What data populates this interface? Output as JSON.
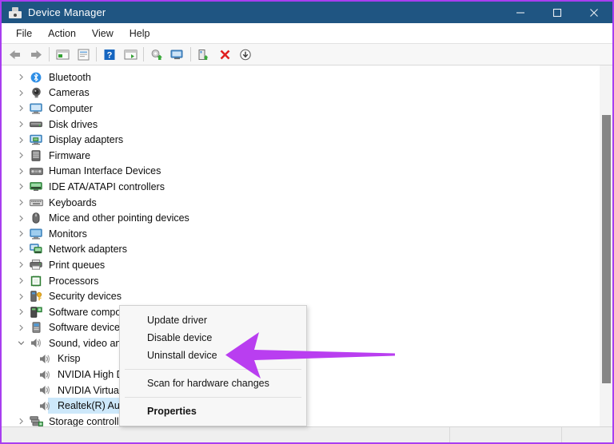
{
  "window": {
    "title": "Device Manager",
    "icon": "device-manager-icon",
    "controls": {
      "minimize": "minimize-icon",
      "maximize": "maximize-icon",
      "close": "close-icon"
    },
    "accent_border": "#a83ef0",
    "titlebar_color": "#1f5582"
  },
  "menubar": {
    "items": [
      {
        "label": "File"
      },
      {
        "label": "Action"
      },
      {
        "label": "View"
      },
      {
        "label": "Help"
      }
    ]
  },
  "toolbar": {
    "buttons": [
      {
        "name": "back-arrow-icon",
        "title": "Back"
      },
      {
        "name": "forward-arrow-icon",
        "title": "Forward"
      },
      {
        "name": "separator-1"
      },
      {
        "name": "show-hidden-devices-icon",
        "title": "Show hidden devices"
      },
      {
        "name": "properties-icon",
        "title": "Properties"
      },
      {
        "name": "separator-2"
      },
      {
        "name": "help-icon",
        "title": "Help"
      },
      {
        "name": "console-icon",
        "title": "Console"
      },
      {
        "name": "separator-3"
      },
      {
        "name": "update-driver-icon",
        "title": "Update driver"
      },
      {
        "name": "scan-hardware-icon",
        "title": "Scan for hardware changes"
      },
      {
        "name": "separator-4"
      },
      {
        "name": "enable-device-icon",
        "title": "Enable device"
      },
      {
        "name": "uninstall-device-icon",
        "title": "Uninstall device"
      },
      {
        "name": "disable-device-icon",
        "title": "Disable device"
      }
    ]
  },
  "tree": {
    "items": [
      {
        "label": "Bluetooth",
        "icon": "bluetooth-icon",
        "expander": "collapsed",
        "level": 0
      },
      {
        "label": "Cameras",
        "icon": "camera-icon",
        "expander": "collapsed",
        "level": 0
      },
      {
        "label": "Computer",
        "icon": "computer-icon",
        "expander": "collapsed",
        "level": 0
      },
      {
        "label": "Disk drives",
        "icon": "disk-drive-icon",
        "expander": "collapsed",
        "level": 0
      },
      {
        "label": "Display adapters",
        "icon": "display-adapter-icon",
        "expander": "collapsed",
        "level": 0
      },
      {
        "label": "Firmware",
        "icon": "firmware-icon",
        "expander": "collapsed",
        "level": 0
      },
      {
        "label": "Human Interface Devices",
        "icon": "hid-icon",
        "expander": "collapsed",
        "level": 0
      },
      {
        "label": "IDE ATA/ATAPI controllers",
        "icon": "ide-controller-icon",
        "expander": "collapsed",
        "level": 0
      },
      {
        "label": "Keyboards",
        "icon": "keyboard-icon",
        "expander": "collapsed",
        "level": 0
      },
      {
        "label": "Mice and other pointing devices",
        "icon": "mouse-icon",
        "expander": "collapsed",
        "level": 0
      },
      {
        "label": "Monitors",
        "icon": "monitor-icon",
        "expander": "collapsed",
        "level": 0
      },
      {
        "label": "Network adapters",
        "icon": "network-adapter-icon",
        "expander": "collapsed",
        "level": 0
      },
      {
        "label": "Print queues",
        "icon": "printer-icon",
        "expander": "collapsed",
        "level": 0
      },
      {
        "label": "Processors",
        "icon": "processor-icon",
        "expander": "collapsed",
        "level": 0
      },
      {
        "label": "Security devices",
        "icon": "security-device-icon",
        "expander": "collapsed",
        "level": 0
      },
      {
        "label": "Software components",
        "icon": "software-component-icon",
        "expander": "collapsed",
        "level": 0
      },
      {
        "label": "Software devices",
        "icon": "software-device-icon",
        "expander": "collapsed",
        "level": 0
      },
      {
        "label": "Sound, video and game controllers",
        "icon": "speaker-icon",
        "expander": "expanded",
        "level": 0
      },
      {
        "label": "Krisp",
        "icon": "speaker-icon",
        "expander": "none",
        "level": 1
      },
      {
        "label": "NVIDIA High Definition Audio",
        "icon": "speaker-icon",
        "expander": "none",
        "level": 1
      },
      {
        "label": "NVIDIA Virtual Audio Device",
        "icon": "speaker-icon",
        "expander": "none",
        "level": 1
      },
      {
        "label": "Realtek(R) Audio",
        "icon": "speaker-icon",
        "expander": "none",
        "level": 1,
        "selected": true
      },
      {
        "label": "Storage controllers",
        "icon": "storage-controller-icon",
        "expander": "collapsed",
        "level": 0
      }
    ]
  },
  "context_menu": {
    "items": [
      {
        "label": "Update driver",
        "type": "item"
      },
      {
        "label": "Disable device",
        "type": "item"
      },
      {
        "label": "Uninstall device",
        "type": "item",
        "highlighted_by_arrow": true
      },
      {
        "type": "separator"
      },
      {
        "label": "Scan for hardware changes",
        "type": "item"
      },
      {
        "type": "separator"
      },
      {
        "label": "Properties",
        "type": "item",
        "bold": true
      }
    ]
  },
  "annotation": {
    "arrow": {
      "name": "callout-arrow",
      "color": "#b93ef0",
      "direction": "left",
      "points_to": "Uninstall device"
    }
  },
  "statusbar": {
    "text": ""
  }
}
